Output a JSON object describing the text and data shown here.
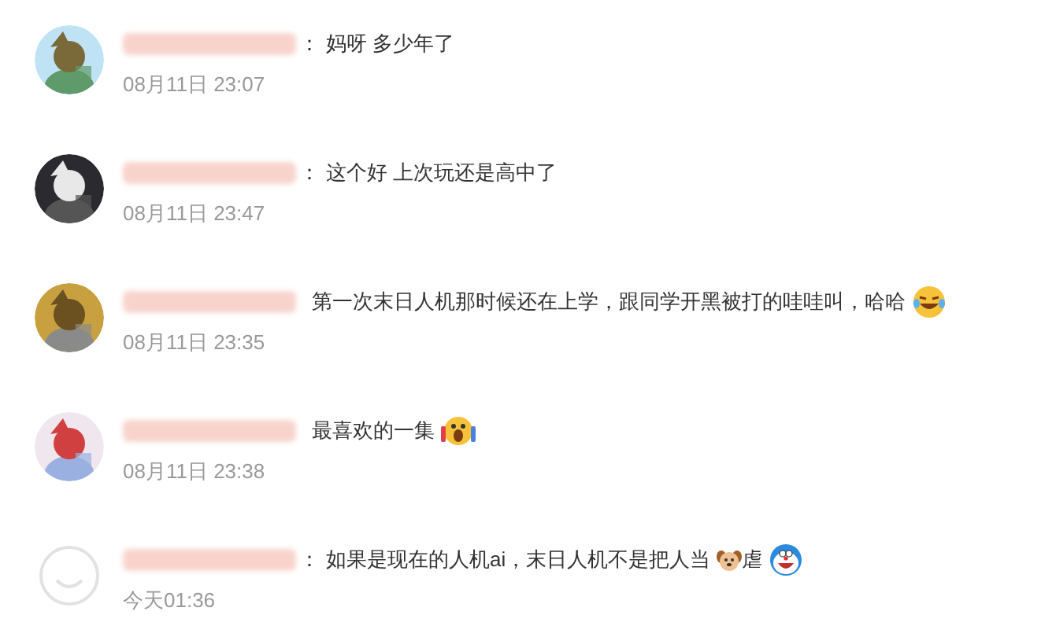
{
  "comments": [
    {
      "avatar": {
        "kind": "picture"
      },
      "separator": "：",
      "parts": [
        {
          "kind": "text",
          "text": "妈呀 多少年了"
        }
      ],
      "time": "08月11日 23:07"
    },
    {
      "avatar": {
        "kind": "picture"
      },
      "separator": "：",
      "parts": [
        {
          "kind": "text",
          "text": "这个好 上次玩还是高中了"
        }
      ],
      "time": "08月11日 23:47"
    },
    {
      "avatar": {
        "kind": "picture"
      },
      "parts": [
        {
          "kind": "text",
          "text": "第一次末日人机那时候还在上学，跟同学开黑被打的哇哇叫，哈哈"
        },
        {
          "kind": "laughing"
        }
      ],
      "time": "08月11日 23:35"
    },
    {
      "avatar": {
        "kind": "picture"
      },
      "parts": [
        {
          "kind": "text",
          "text": "最喜欢的一集"
        },
        {
          "kind": "screaming"
        }
      ],
      "time": "08月11日 23:38"
    },
    {
      "avatar": {
        "kind": "default"
      },
      "separator": "：",
      "parts": [
        {
          "kind": "text",
          "text": "如果是现在的人机ai，末日人机不是把人当"
        },
        {
          "kind": "dog"
        },
        {
          "kind": "text",
          "text": "虐"
        },
        {
          "kind": "grinning"
        }
      ],
      "time": "今天01:36"
    }
  ]
}
